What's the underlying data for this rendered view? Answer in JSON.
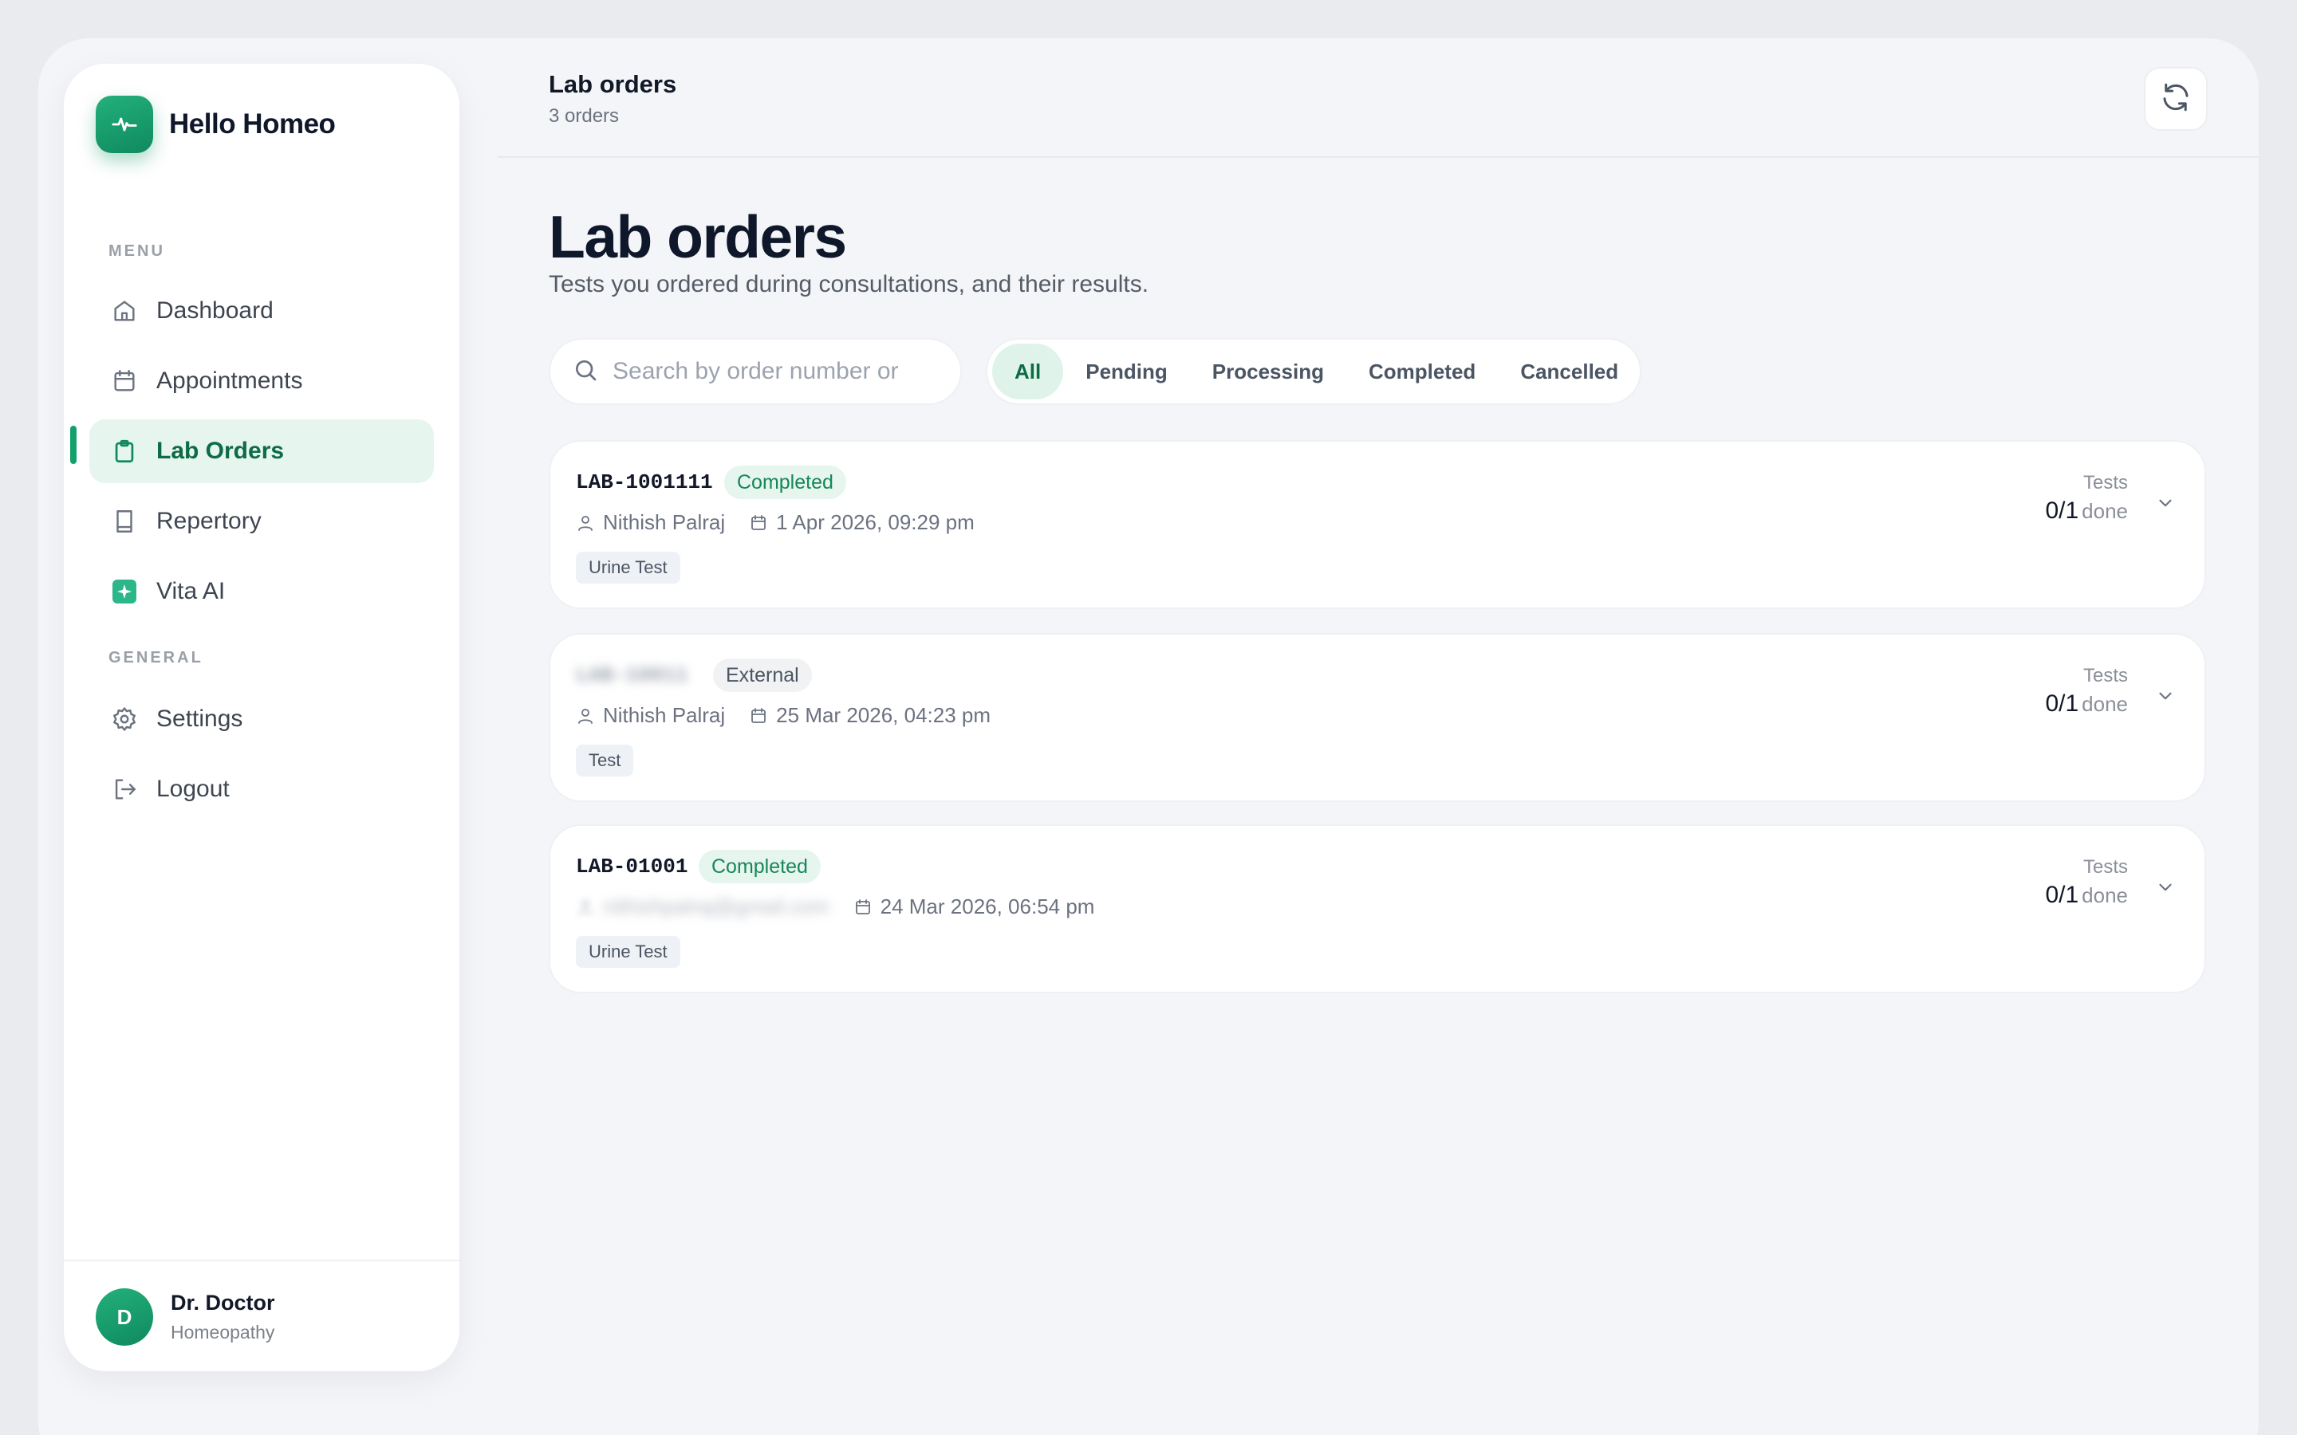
{
  "brand": {
    "name": "Hello Homeo"
  },
  "sidebar": {
    "menu_label": "MENU",
    "general_label": "GENERAL",
    "items": [
      {
        "label": "Dashboard",
        "icon": "home-icon"
      },
      {
        "label": "Appointments",
        "icon": "calendar-icon"
      },
      {
        "label": "Lab Orders",
        "icon": "clipboard-icon",
        "active": true
      },
      {
        "label": "Repertory",
        "icon": "book-icon"
      },
      {
        "label": "Vita AI",
        "icon": "sparkle-icon"
      }
    ],
    "general_items": [
      {
        "label": "Settings",
        "icon": "gear-icon"
      },
      {
        "label": "Logout",
        "icon": "logout-icon"
      }
    ],
    "profile": {
      "initial": "D",
      "name": "Dr. Doctor",
      "role": "Homeopathy"
    }
  },
  "header": {
    "title": "Lab orders",
    "subtitle": "3 orders"
  },
  "page": {
    "title": "Lab orders",
    "subtitle": "Tests you ordered during consultations, and their results."
  },
  "search": {
    "placeholder": "Search by order number or patient",
    "value": ""
  },
  "filters": [
    "All",
    "Pending",
    "Processing",
    "Completed",
    "Cancelled"
  ],
  "orders": [
    {
      "order_no": "LAB-1001111",
      "status": "Completed",
      "patient": "Nithish Palraj",
      "date": "1 Apr 2026, 09:29 pm",
      "test": "Urine Test",
      "tests_label": "Tests",
      "tests_count": "0/1",
      "done_label": "done"
    },
    {
      "order_no": "LAB-10011",
      "status": "External",
      "patient": "Nithish Palraj",
      "date": "25 Mar 2026, 04:23 pm",
      "test": "Test",
      "tests_label": "Tests",
      "tests_count": "0/1",
      "done_label": "done"
    },
    {
      "order_no": "LAB-01001",
      "status": "Completed",
      "patient": "nithishpalraj@gmail.com",
      "date": "24 Mar 2026, 06:54 pm",
      "test": "Urine Test",
      "tests_label": "Tests",
      "tests_count": "0/1",
      "done_label": "done"
    }
  ],
  "colors": {
    "accent": "#14a06c",
    "accent_bg": "#e6f5ee",
    "text": "#111827"
  }
}
